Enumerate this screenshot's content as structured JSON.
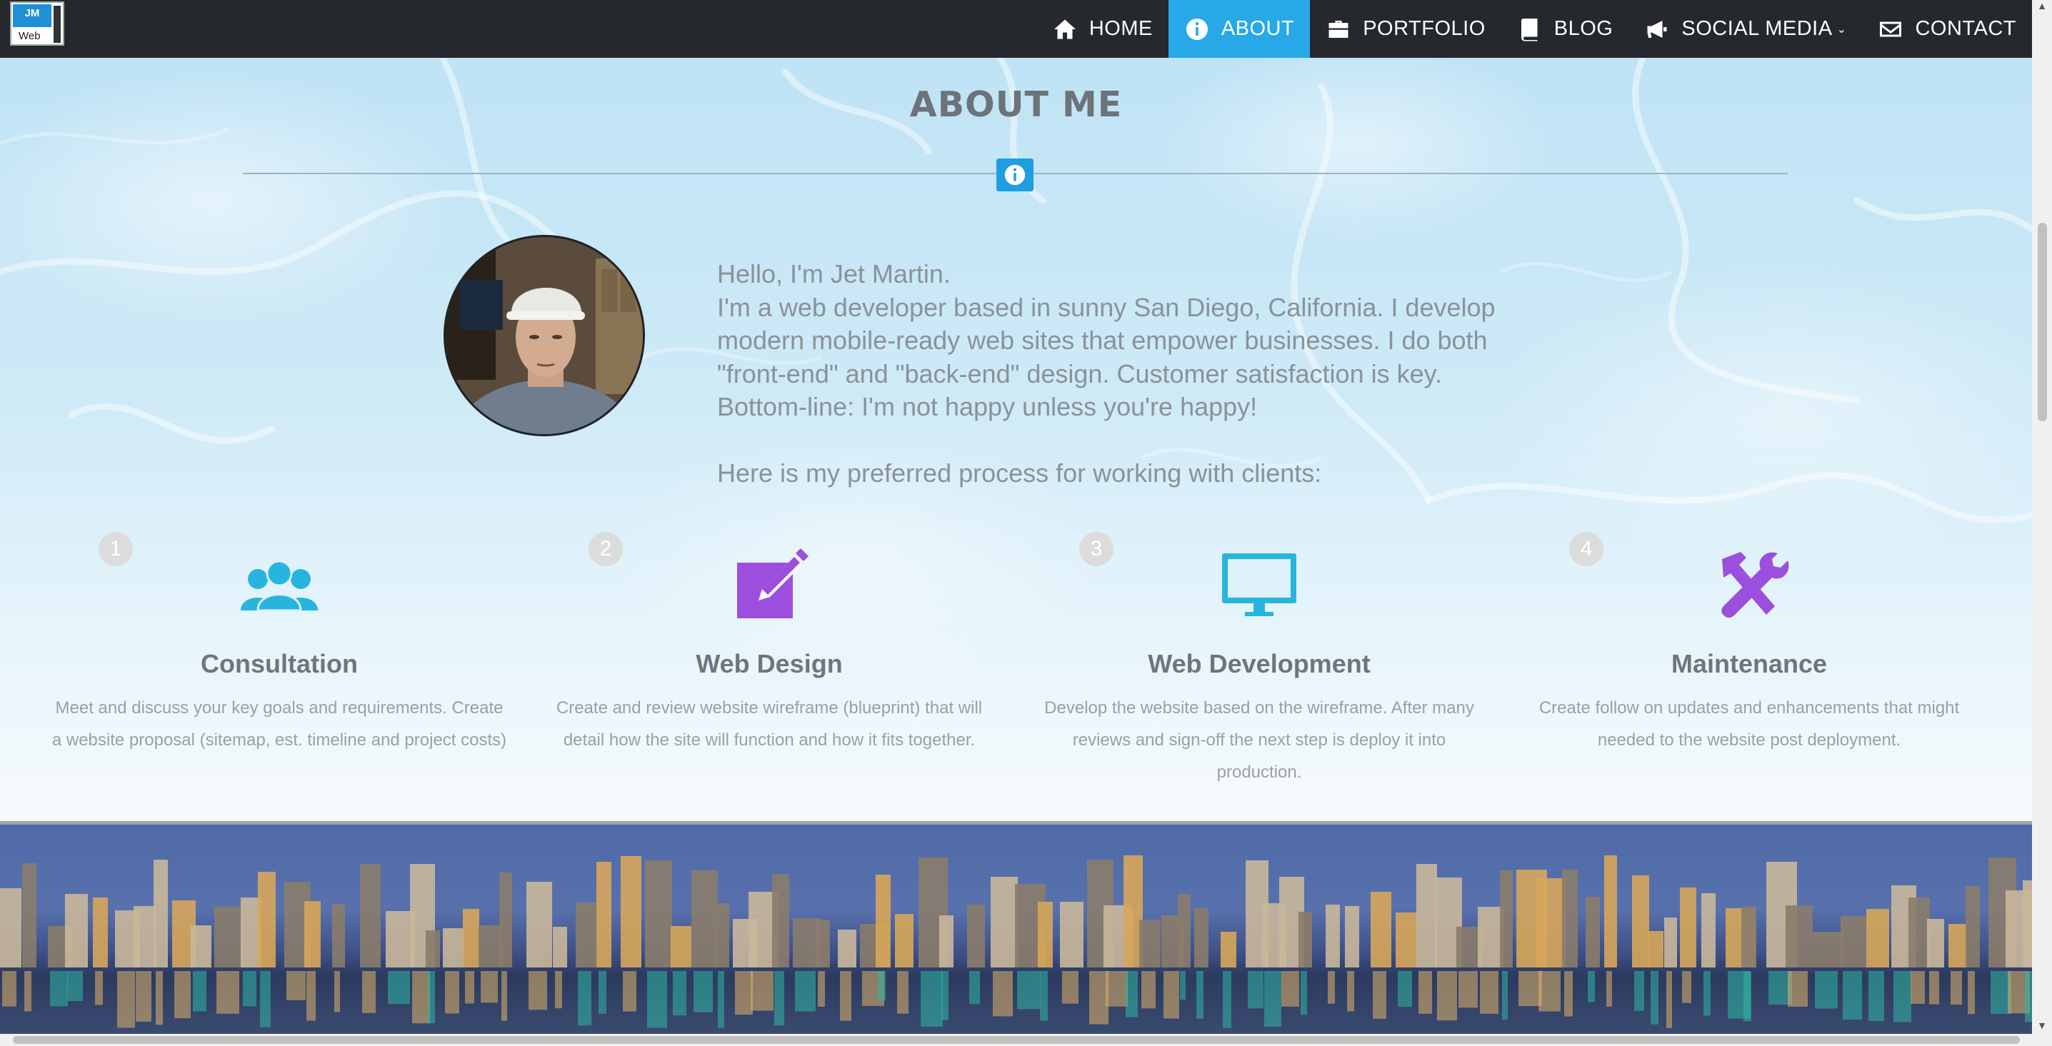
{
  "nav": {
    "logo_top": "JM",
    "logo_word": "Web",
    "items": [
      {
        "label": "HOME",
        "icon": "home-icon"
      },
      {
        "label": "ABOUT",
        "icon": "info-icon",
        "active": true
      },
      {
        "label": "PORTFOLIO",
        "icon": "briefcase-icon"
      },
      {
        "label": "BLOG",
        "icon": "book-icon"
      },
      {
        "label": "SOCIAL MEDIA",
        "icon": "megaphone-icon",
        "caret": "⌄"
      },
      {
        "label": "CONTACT",
        "icon": "envelope-icon"
      }
    ],
    "active_color": "#28a8e6",
    "bar_color": "#25292d"
  },
  "about": {
    "title": "ABOUT ME",
    "bio_lines": [
      "Hello, I'm Jet Martin.",
      "I'm a web developer based in sunny San Diego, California. I develop modern mobile-ready web sites that empower businesses. I do both \"front-end\" and \"back-end\" design. Customer satisfaction is key. Bottom-line: I'm not happy unless you're happy!",
      "Here is my preferred process for working with clients:"
    ],
    "steps": [
      {
        "num": "1",
        "title": "Consultation",
        "desc": "Meet and discuss your key goals and requirements. Create a website proposal (sitemap, est. timeline and project costs)",
        "icon": "users-icon",
        "color": "#27b5dd"
      },
      {
        "num": "2",
        "title": "Web Design",
        "desc": "Create and review website wireframe (blueprint) that will detail how the site will function and how it fits together.",
        "icon": "edit-icon",
        "color": "#9b4fdc"
      },
      {
        "num": "3",
        "title": "Web Development",
        "desc": "Develop the website based on the wireframe. After many reviews and sign-off the next step is deploy it into production.",
        "icon": "monitor-icon",
        "color": "#27b5dd"
      },
      {
        "num": "4",
        "title": "Maintenance",
        "desc": "Create follow on updates and enhancements that might needed to the website post deployment.",
        "icon": "tools-icon",
        "color": "#9b4fdc"
      }
    ]
  }
}
